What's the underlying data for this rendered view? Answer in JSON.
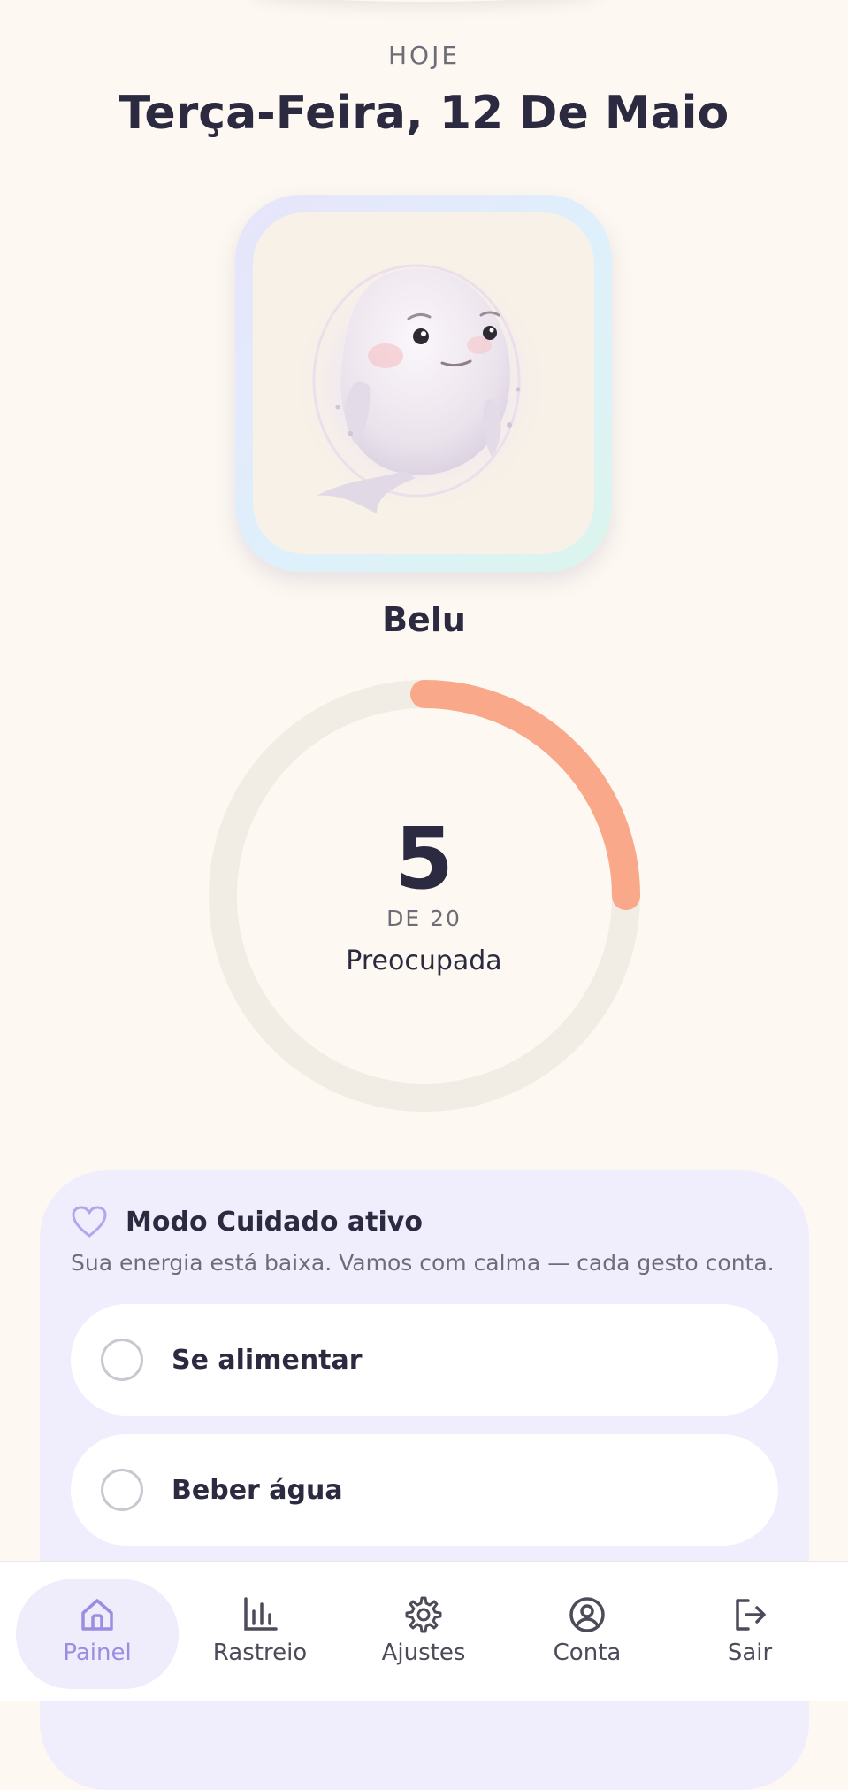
{
  "header": {
    "eyebrow": "HOJE",
    "date": "Terça-Feira, 12 De Maio"
  },
  "pet": {
    "name": "Belu",
    "illustration": "beluga-whale-worried"
  },
  "energy": {
    "value": "5",
    "total": "DE 20",
    "mood": "Preocupada",
    "fraction": 0.25,
    "color": "#f9a88a",
    "track_color": "#f2ede4"
  },
  "care_mode": {
    "title": "Modo Cuidado ativo",
    "description": "Sua energia está baixa. Vamos com calma — cada gesto conta.",
    "icon": "heart-outline-icon",
    "tasks": [
      {
        "label": "Se alimentar",
        "done": false
      },
      {
        "label": "Beber água",
        "done": false
      }
    ]
  },
  "nav": {
    "items": [
      {
        "label": "Painel",
        "icon": "home-icon",
        "active": true
      },
      {
        "label": "Rastreio",
        "icon": "bar-chart-icon",
        "active": false
      },
      {
        "label": "Ajustes",
        "icon": "gear-icon",
        "active": false
      },
      {
        "label": "Conta",
        "icon": "user-circle-icon",
        "active": false
      },
      {
        "label": "Sair",
        "icon": "logout-icon",
        "active": false
      }
    ]
  },
  "colors": {
    "background": "#fdf8f1",
    "accent": "#9b8de0",
    "card": "#f0eefd",
    "text": "#2b2a40"
  }
}
